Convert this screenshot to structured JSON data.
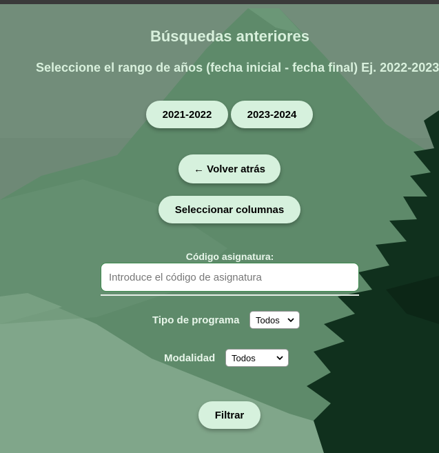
{
  "header": {
    "title": "Búsquedas anteriores",
    "subtitle": "Seleccione el rango de años (fecha inicial - fecha final) Ej. 2022-2023"
  },
  "year_ranges": [
    {
      "label": "2021-2022"
    },
    {
      "label": "2023-2024"
    }
  ],
  "actions": {
    "back_label": "← Volver atrás",
    "select_columns_label": "Seleccionar columnas",
    "filter_label": "Filtrar"
  },
  "filters": {
    "subject_code": {
      "label": "Código asignatura:",
      "value": "",
      "placeholder": "Introduce el código de asignatura"
    },
    "program_type": {
      "label": "Tipo de programa",
      "selected": "Todos"
    },
    "modality": {
      "label": "Modalidad",
      "selected": "Todos"
    }
  },
  "colors": {
    "button_bg": "#d6f1dd",
    "heading_text": "#d8f0dc",
    "input_border": "#3e8a4e",
    "tree_dark": "#0f2b1a",
    "mountain": "#5f8a6b"
  }
}
